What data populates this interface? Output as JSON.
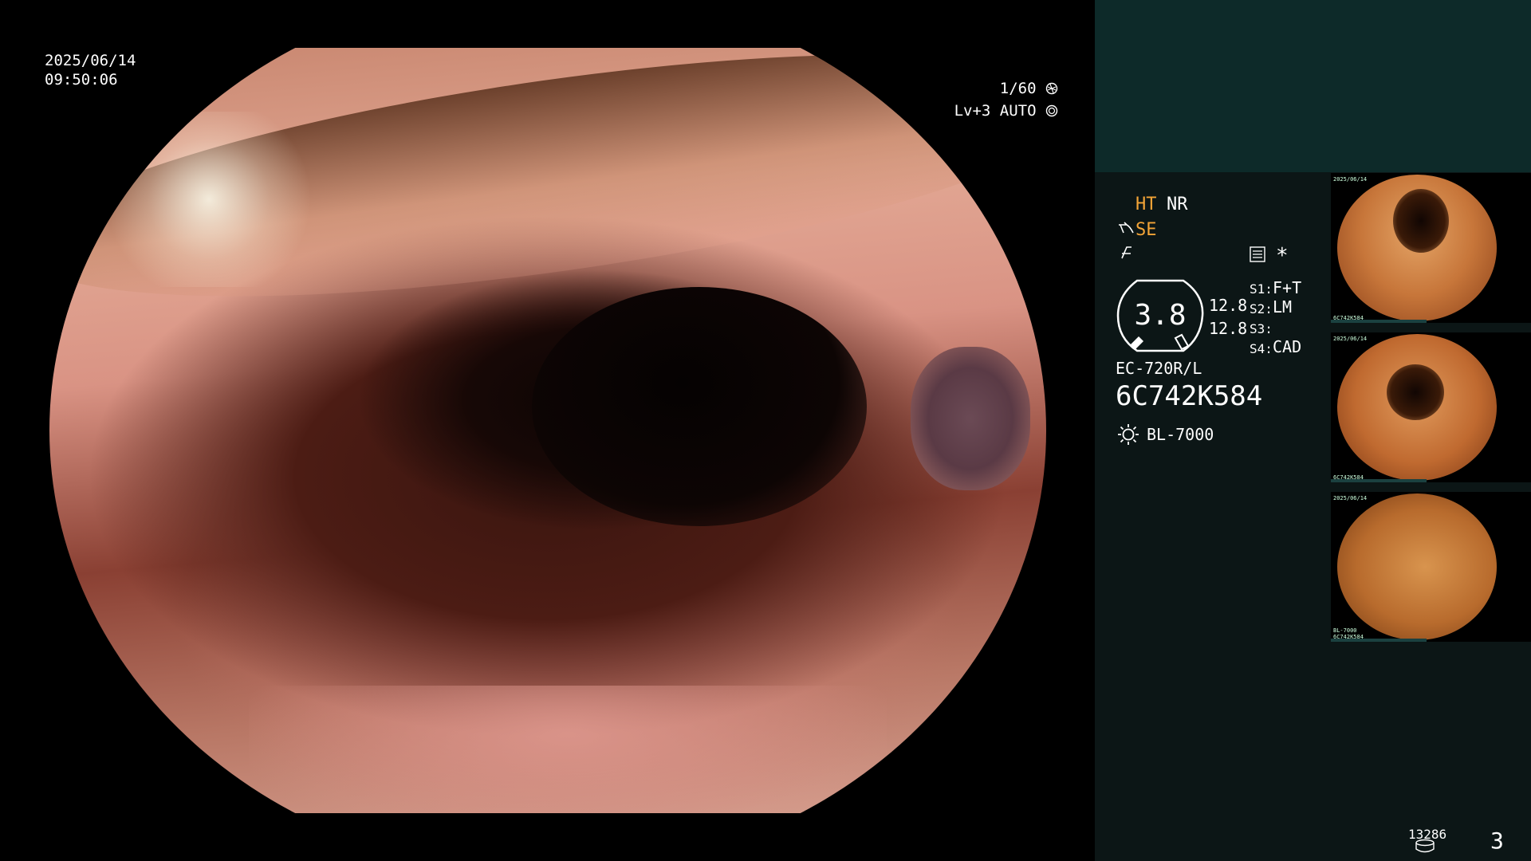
{
  "overlay": {
    "date": "2025/06/14",
    "time": "09:50:06",
    "shutter": "1/60",
    "shutter_icon": "aperture-icon",
    "level": "Lv+3 AUTO",
    "level_icon": "auto-exposure-icon"
  },
  "panel": {
    "ht": "HT",
    "nr": "NR",
    "se": "SE",
    "se_icon": "scope-enhance-icon",
    "f_icon": "f-toggle-icon",
    "menu_icon": "menu-list-icon",
    "asterisk": "*",
    "gauge_value": "3.8",
    "value1": "12.8",
    "value2": "12.8",
    "switches": [
      {
        "label": "S1:",
        "value": "F+T"
      },
      {
        "label": "S2:",
        "value": "LM"
      },
      {
        "label": "S3:",
        "value": ""
      },
      {
        "label": "S4:",
        "value": "CAD"
      }
    ],
    "model": "EC-720R/L",
    "serial": "6C742K584",
    "light_source_icon": "light-source-icon",
    "light_source": "BL-7000",
    "storage_count": "13286",
    "storage_icon": "storage-disk-icon",
    "page_number": "3",
    "thumbnails_meta_serial": "6C742K584",
    "thumbnails_meta_date": "2025/06/14",
    "thumbnails_meta_light": "BL-7000"
  },
  "colors": {
    "panel_top": "#0d2a29",
    "panel_main": "#0c1616",
    "accent_orange": "#f3a437"
  }
}
